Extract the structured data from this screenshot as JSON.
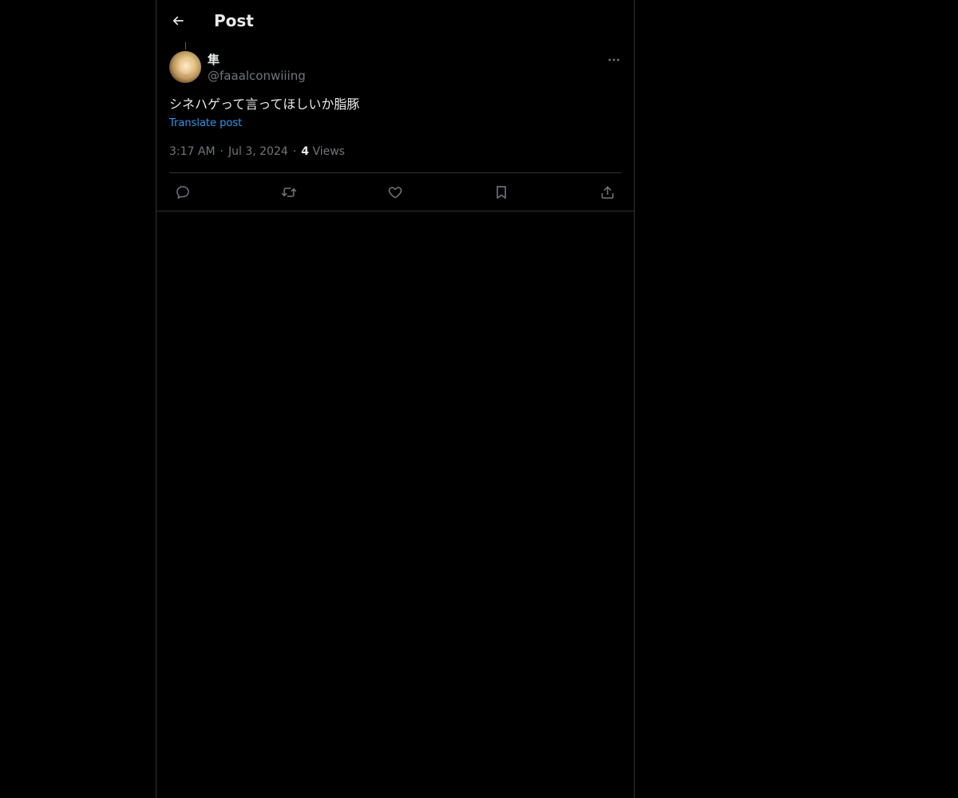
{
  "header": {
    "title": "Post",
    "back_icon": "arrow-left-icon"
  },
  "post": {
    "author": {
      "name": "隼",
      "handle": "@faaalconwiiing"
    },
    "text": "シネハゲって言ってほしいか脂豚",
    "translate_label": "Translate post",
    "time": "3:17 AM",
    "date": "Jul 3, 2024",
    "views_count": "4",
    "views_label": "Views",
    "more_icon": "ellipsis-icon"
  },
  "actions": {
    "reply": "reply-icon",
    "repost": "repost-icon",
    "like": "heart-icon",
    "bookmark": "bookmark-icon",
    "share": "share-icon"
  },
  "colors": {
    "background": "#000000",
    "text_primary": "#e7e9ea",
    "text_secondary": "#71767b",
    "link": "#1d9bf0",
    "border": "#2f3336"
  }
}
